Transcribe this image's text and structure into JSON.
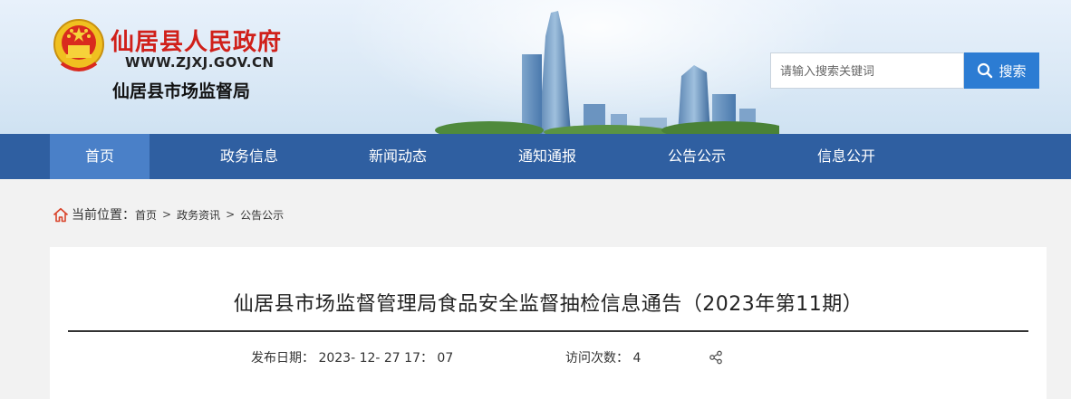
{
  "header": {
    "site_title": "仙居县人民政府",
    "site_url": "WWW.ZJXJ.GOV.CN",
    "department": "仙居县市场监督局",
    "emblem_icon": "national-emblem-icon",
    "search": {
      "placeholder": "请输入搜索关键词",
      "button_label": "搜索",
      "button_icon": "search-icon"
    }
  },
  "nav": {
    "items": [
      {
        "label": "首页",
        "active": true
      },
      {
        "label": "政务信息",
        "active": false
      },
      {
        "label": "新闻动态",
        "active": false
      },
      {
        "label": "通知通报",
        "active": false
      },
      {
        "label": "公告公示",
        "active": false
      },
      {
        "label": "信息公开",
        "active": false
      }
    ]
  },
  "breadcrumb": {
    "icon": "home-icon",
    "lead": "当前位置：",
    "items": [
      "首页",
      "政务资讯",
      "公告公示"
    ],
    "separator": ">"
  },
  "article": {
    "title": "仙居县市场监督管理局食品安全监督抽检信息通告（2023年第11期）",
    "publish_label": "发布日期：",
    "publish_value": "2023- 12- 27 17： 07",
    "visits_label": "访问次数：",
    "visits_value": "4",
    "share_icon": "share-icon"
  },
  "colors": {
    "brand_red": "#d0201a",
    "nav_bg": "#2f5fa1",
    "nav_active": "#4a80c8",
    "search_button": "#2c7cd3"
  }
}
